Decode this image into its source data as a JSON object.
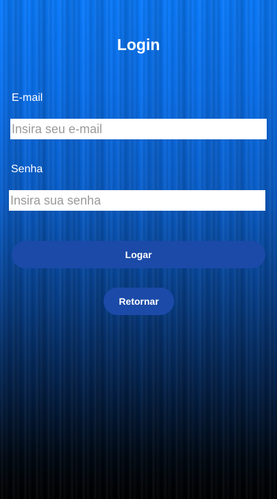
{
  "header": {
    "title": "Login"
  },
  "form": {
    "email_label": "E-mail",
    "email_placeholder": "Insira seu e-mail",
    "email_value": "",
    "password_label": "Senha",
    "password_placeholder": "Insira sua senha",
    "password_value": ""
  },
  "actions": {
    "login_label": "Logar",
    "back_label": "Retornar"
  },
  "colors": {
    "button_bg": "#1b4aa8",
    "background_top": "#0a7cff",
    "background_bottom": "#000000"
  }
}
